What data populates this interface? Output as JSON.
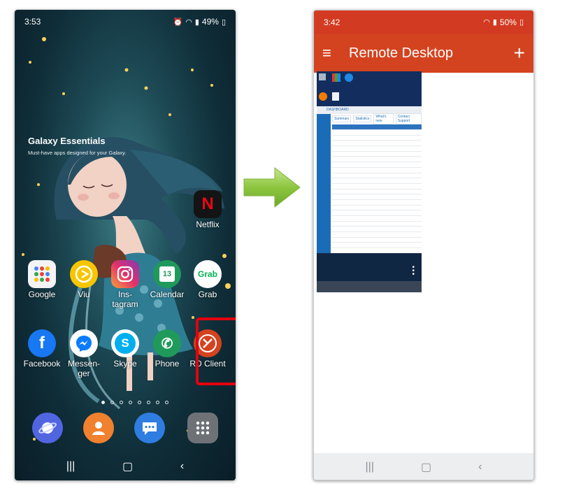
{
  "left_phone": {
    "status": {
      "time": "3:53",
      "battery": "49%"
    },
    "widget": {
      "title": "Galaxy Essentials",
      "subtitle": "Must-have apps designed for your Galaxy."
    },
    "apps": {
      "netflix": "Netflix",
      "google": "Google",
      "viu": "Viu",
      "instagram": "Ins-\ntagram",
      "calendar": "Calendar",
      "calendar_day": "13",
      "grab": "Grab",
      "facebook": "Facebook",
      "messenger": "Messen-\nger",
      "skype": "Skype",
      "phone": "Phone",
      "rd_client": "RD Client"
    }
  },
  "right_phone": {
    "status": {
      "time": "3:42",
      "battery": "50%"
    },
    "appbar": {
      "title": "Remote Desktop",
      "add_symbol": "+"
    },
    "thumbnail": {
      "window_title": "DASHBOARD",
      "tabs": [
        "Summary",
        "Statistics",
        "What's new",
        "Contact Support"
      ]
    }
  },
  "colors": {
    "highlight": "#e3000f",
    "rd_accent": "#d4431f",
    "arrow": "#8cc63f"
  },
  "icons": [
    "menu-icon",
    "add-icon",
    "wifi-icon",
    "alarm-icon",
    "battery-icon",
    "back-icon",
    "home-icon",
    "recents-icon",
    "right-arrow-icon"
  ]
}
